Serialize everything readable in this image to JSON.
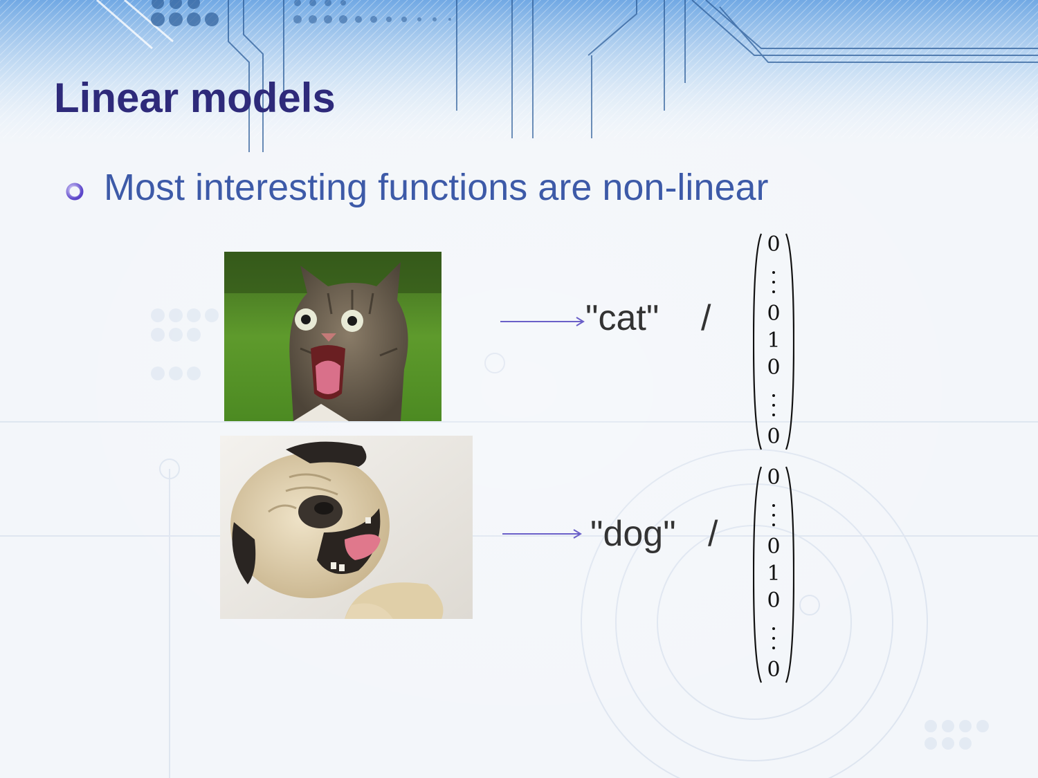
{
  "slide": {
    "title": "Linear models",
    "bullets": [
      {
        "text": "Most interesting functions are non-linear"
      }
    ],
    "examples": [
      {
        "image": "cat-photo",
        "label": "\"cat\"",
        "separator": "/",
        "vector": [
          "0",
          "⋮",
          "0",
          "1",
          "0",
          "⋮",
          "0"
        ]
      },
      {
        "image": "dog-photo",
        "label": "\"dog\"",
        "separator": "/",
        "vector": [
          "0",
          "⋮",
          "0",
          "1",
          "0",
          "⋮",
          "0"
        ]
      }
    ],
    "colors": {
      "title": "#2e2a7a",
      "bullet_text": "#3d5aa8",
      "arrow": "#6a5fc8",
      "label_text": "#333333"
    },
    "icons": {
      "bullet": "hollow-circle-bullet-icon",
      "arrow": "right-arrow-icon"
    }
  }
}
